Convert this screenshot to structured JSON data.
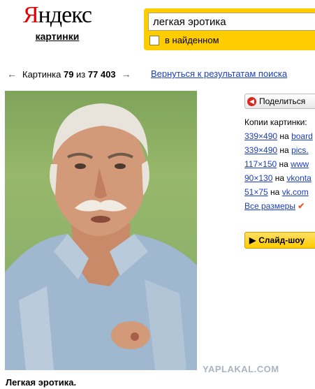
{
  "header": {
    "logo_y": "Я",
    "logo_rest": "ндекс",
    "service_label": "картинки"
  },
  "search": {
    "query": "легкая эротика",
    "within_found_label": "в найденном"
  },
  "nav": {
    "prev_arrow": "←",
    "position_prefix": "Картинка ",
    "current": "79",
    "of_word": " из ",
    "total": "77 403",
    "next_arrow": "→",
    "back_link": "Вернуться к результатам поиска"
  },
  "sidebar": {
    "share_label": "Поделиться",
    "copies_title": "Копии картинки:",
    "copies": [
      {
        "size": "339×490",
        "on": "на",
        "site": "board"
      },
      {
        "size": "339×490",
        "on": "на",
        "site": "pics."
      },
      {
        "size": "117×150",
        "on": "на",
        "site": "www"
      },
      {
        "size": "90×130",
        "on": "на",
        "site": "vkonta"
      },
      {
        "size": "51×75",
        "on": "на",
        "site": "vk.com"
      }
    ],
    "all_sizes_label": "Все размеры",
    "slideshow_label": "Слайд-шоу"
  },
  "watermark": "YAPLAKAL.COM",
  "caption": "Легкая эротика."
}
